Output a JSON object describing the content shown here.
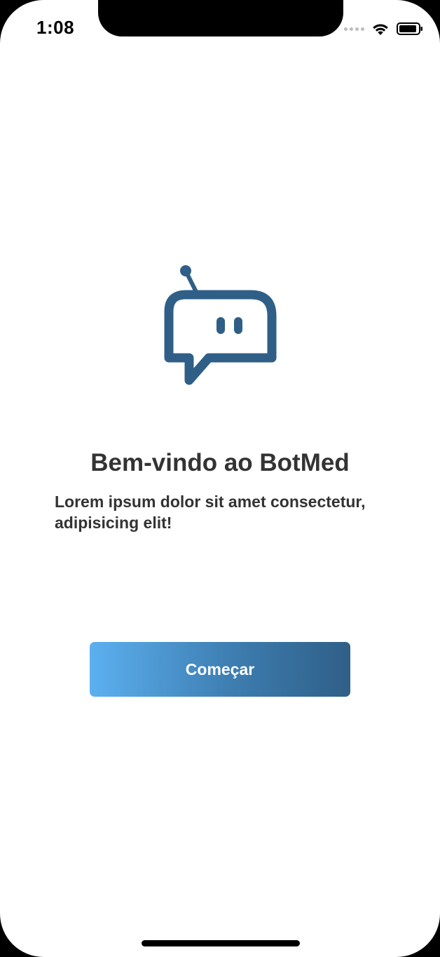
{
  "status_bar": {
    "time": "1:08"
  },
  "welcome": {
    "icon": "chat-bot-icon",
    "title": "Bem-vindo ao BotMed",
    "subtitle": "Lorem ipsum dolor sit amet consectetur, adipisicing elit!"
  },
  "actions": {
    "start_label": "Começar"
  },
  "colors": {
    "brand": "#2f5f87",
    "gradient_start": "#5cb0f0",
    "text": "#333333"
  }
}
